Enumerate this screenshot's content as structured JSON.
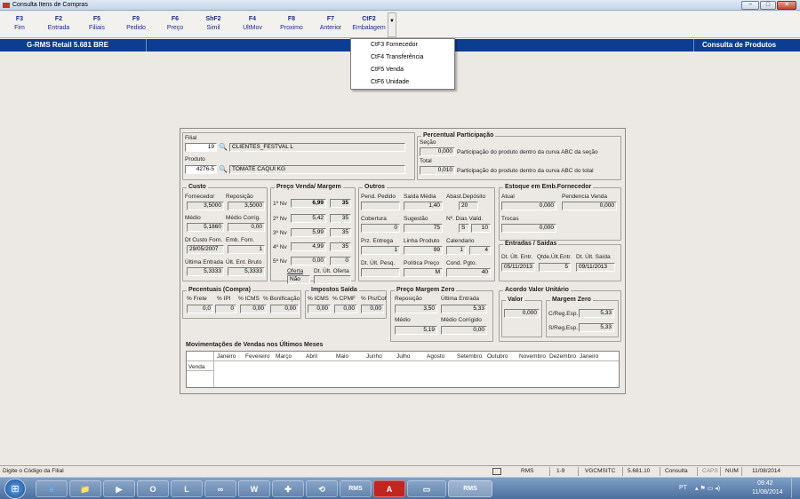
{
  "window": {
    "title": "Consulta Itens de Compras",
    "controls": {
      "minimize": "−",
      "maximize": "□",
      "close": "✕"
    }
  },
  "toolbar": [
    {
      "key": "F3",
      "label": "Fim"
    },
    {
      "key": "F2",
      "label": "Entrada"
    },
    {
      "key": "F5",
      "label": "Filiais"
    },
    {
      "key": "F9",
      "label": "Pedido"
    },
    {
      "key": "F6",
      "label": "Preço"
    },
    {
      "key": "ShF2",
      "label": "Simil"
    },
    {
      "key": "F4",
      "label": "UltMov"
    },
    {
      "key": "F8",
      "label": "Proximo"
    },
    {
      "key": "F7",
      "label": "Anterior"
    },
    {
      "key": "CtF2",
      "label": "Embalagem"
    }
  ],
  "toolbar_arrow": "▼",
  "dropdown": [
    "CtF3  Fornecedor",
    "CtF4  Transferência",
    "CtF5  Venda",
    "CtF6  Unidade"
  ],
  "bluebar": {
    "left": "G-RMS Retail 5.681 BRE",
    "right": "Consulta de Produtos"
  },
  "header": {
    "filial_label": "Filial",
    "filial_code": "19",
    "filial_name": "CLIENTES_FESTVAL L",
    "produto_label": "Produto",
    "produto_code": "4276-5",
    "produto_name": "TOMATE CAQUI KG",
    "binoc_icon": "🔍"
  },
  "participacao": {
    "title": "Percentual Participação",
    "secao_label": "Seção",
    "secao_value": "0,000",
    "secao_text": "Participação do produto dentro da curva ABC da seção",
    "total_label": "Total",
    "total_value": "0,010",
    "total_text": "Participação do produto dentro da curva ABC do total"
  },
  "custo": {
    "title": "Custo",
    "fornecedor_label": "Fornecedor",
    "fornecedor": "3,5000",
    "reposicao_label": "Reposição",
    "reposicao": "3,5000",
    "medio_label": "Médio",
    "medio": "5,1860",
    "medio_corrig_label": "Médio Corrig.",
    "medio_corrig": "0,00",
    "dt_custo_label": "Dt Custo Forn.",
    "dt_custo": "29/05/2007",
    "emb_forn_label": "Emb. Forn.",
    "emb_forn": "1",
    "ultima_entrada_label": "Última Entrada",
    "ultima_entrada": "5,3333",
    "ult_ent_bruto_label": "Últ. Ent. Bruto",
    "ult_ent_bruto": "5,3333"
  },
  "preco": {
    "title": "Preço Venda/ Margem",
    "levels": [
      {
        "label": "1º Nv",
        "price": "6,99",
        "margin": "35"
      },
      {
        "label": "2º Nv",
        "price": "5,42",
        "margin": "35"
      },
      {
        "label": "3º Nv",
        "price": "5,99",
        "margin": "35"
      },
      {
        "label": "4º Nv",
        "price": "4,99",
        "margin": "35"
      },
      {
        "label": "5º Nv",
        "price": "0,00",
        "margin": "0"
      }
    ],
    "oferta_label": "Oferta",
    "oferta": "Não",
    "dt_ult_oferta_label": "Dt. Últ. Oferta",
    "dt_ult_oferta": ""
  },
  "outros": {
    "title": "Outros",
    "pend_pedido_label": "Pend. Pedido",
    "pend_pedido": "",
    "saida_media_label": "Saída Média",
    "saida_media": "1,40",
    "abast_label": "Abast.Depósito",
    "abast": "20",
    "cobertura_label": "Cobertura",
    "cobertura": "0",
    "sugestao_label": "Sugestão",
    "sugestao": "75",
    "dias_valid_label": "Nº. Dias Valid.",
    "dias_valid_flag": "S",
    "dias_valid": "10",
    "prz_entrega_label": "Prz. Entrega",
    "prz_entrega": "1",
    "linha_produto_label": "Linha Produto",
    "linha_produto": "99",
    "calendario_label": "Calendario",
    "calendario_a": "1",
    "calendario_b": "4",
    "dt_ult_pesq_label": "Dt. Últ. Pesq.",
    "dt_ult_pesq": "",
    "politica_label": "Política Preço",
    "politica": "M",
    "cond_pgto_label": "Cond. Pgto.",
    "cond_pgto": "40"
  },
  "estoque": {
    "title": "Estoque em Emb.Fornecedor",
    "atual_label": "Atual",
    "atual": "0,000",
    "pendencia_label": "Pendencia Venda",
    "pendencia": "0,000",
    "trocas_label": "Trocas",
    "trocas": "0,000"
  },
  "entradas": {
    "title": "Entradas / Saídas",
    "dt_ult_entr_label": "Dt. Últ. Entr.",
    "dt_ult_entr": "05/11/2013",
    "qtde_label": "Qtde.Últ.Entr.",
    "qtde": "5",
    "dt_ult_saida_label": "Dt. Últ. Saída",
    "dt_ult_saida": "09/11/2013"
  },
  "percentuais": {
    "title": "Pecentuais (Compra)",
    "frete_label": "% Frete",
    "frete": "0,0",
    "ipi_label": "% IPI",
    "ipi": "0",
    "icms_label": "% ICMS",
    "icms": "0,00",
    "bonif_label": "% Bonificação",
    "bonif": "0,00"
  },
  "impostos": {
    "title": "Impostos Saída",
    "icms_label": "% ICMS",
    "icms": "0,00",
    "cpmf_label": "% CPMF",
    "cpmf": "0,00",
    "pis_label": "% Pis/Cof",
    "pis": "0,00"
  },
  "margem_zero": {
    "title": "Preço Margem Zero",
    "reposicao_label": "Reposição",
    "reposicao": "3,50",
    "ultima_entrada_label": "Última Entrada",
    "ultima_entrada": "5,33",
    "medio_label": "Médio",
    "medio": "5,19",
    "medio_corrigido_label": "Médio Corrigido",
    "medio_corrigido": "0,00"
  },
  "acordo": {
    "title": "Acordo Valor Unitário",
    "valor_label": "Valor",
    "valor": "0,000",
    "margem_title": "Margem Zero",
    "creg_label": "C/Reg.Esp.",
    "creg": "5,33",
    "sreg_label": "S/Reg.Esp.",
    "sreg": "5,33"
  },
  "movimentacoes": {
    "title": "Movimentações de Vendas nos Últimos Meses",
    "months": [
      "Janeiro",
      "Fevereiro",
      "Março",
      "Abril",
      "Maio",
      "Junho",
      "Julho",
      "Agosto",
      "Setembro",
      "Outubro",
      "Novembro",
      "Dezembro",
      "Janeiro"
    ],
    "row_label": "Venda"
  },
  "status": {
    "message": "Digite o Código da Filial",
    "sys": "RMS",
    "range": "1-9",
    "user": "VGCMSITC",
    "version": "5.681.10",
    "mode": "Consulta",
    "caps": "CAPS",
    "num": "NUM",
    "date": "11/08/2014"
  },
  "taskbar": {
    "items": [
      "e",
      "📁",
      "▶",
      "O",
      "L",
      "∞",
      "W",
      "✚",
      "⟲",
      "RMS",
      "A",
      "▭",
      "RMS"
    ],
    "lang": "PT",
    "time": "09:42",
    "date": "11/08/2014"
  }
}
